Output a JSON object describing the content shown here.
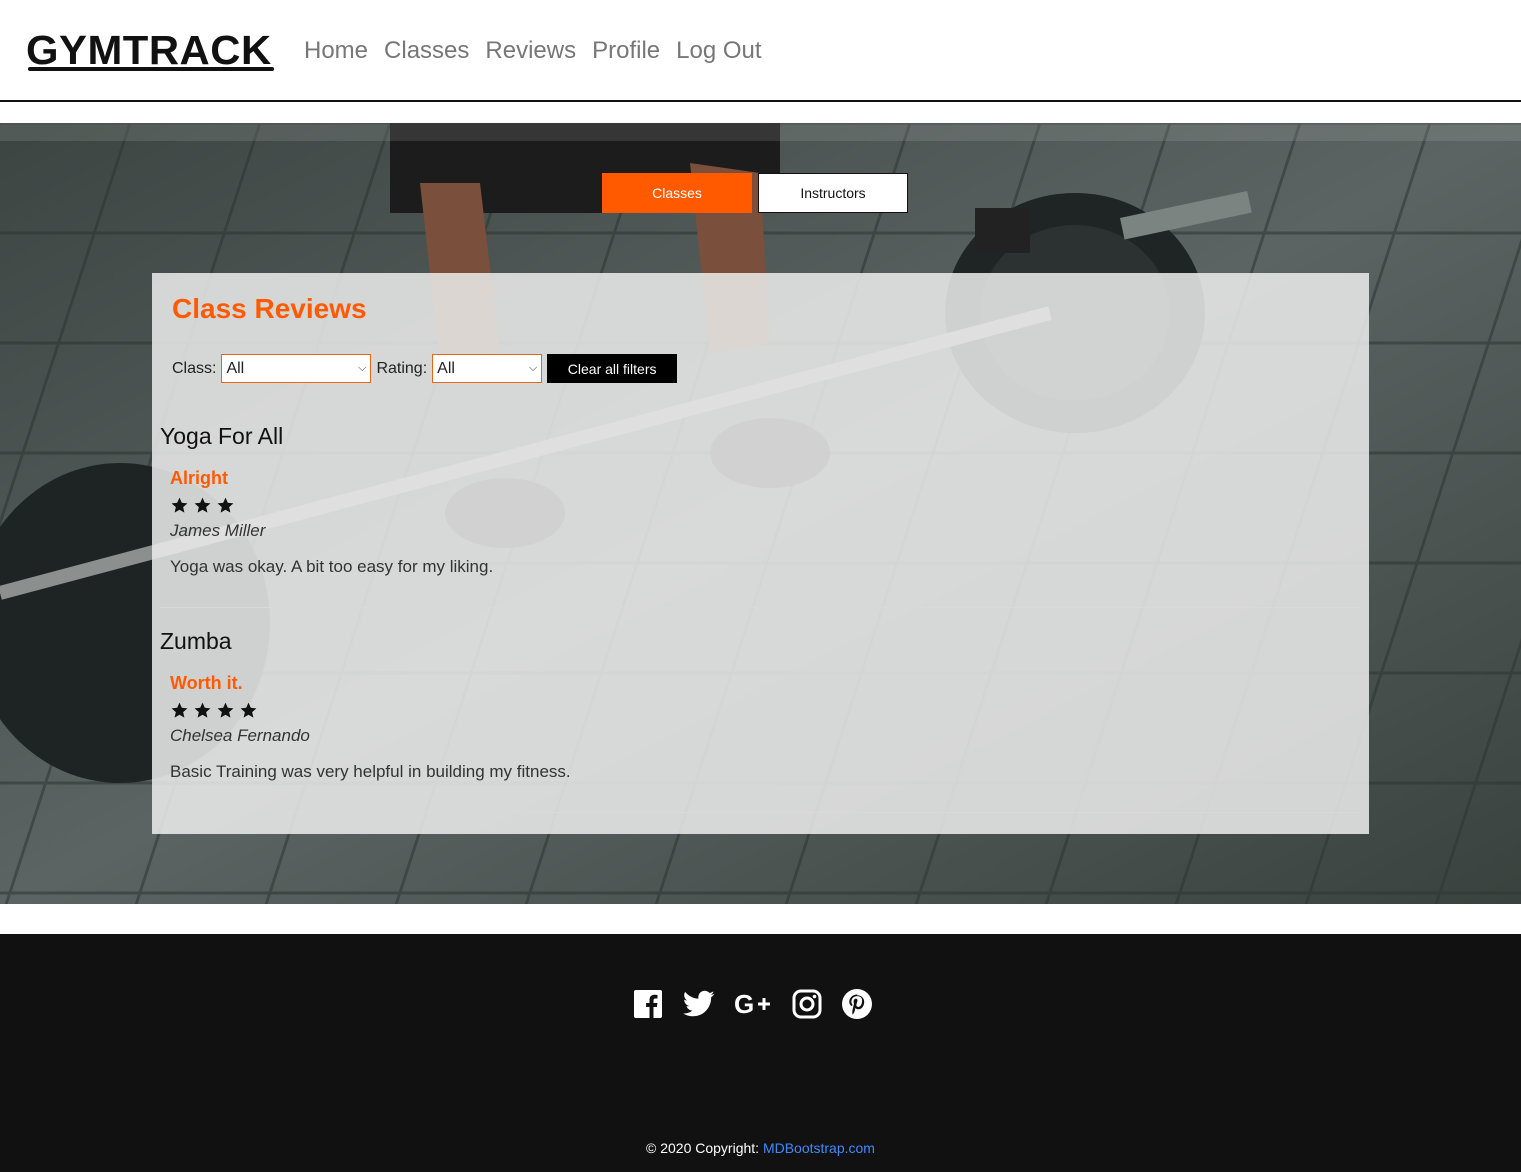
{
  "header": {
    "logo_text": "GYMTRACK",
    "nav": [
      "Home",
      "Classes",
      "Reviews",
      "Profile",
      "Log Out"
    ]
  },
  "toggle": {
    "classes_label": "Classes",
    "instructors_label": "Instructors",
    "active": "Classes"
  },
  "reviews_panel": {
    "title": "Class Reviews",
    "filters": {
      "class_label": "Class:",
      "class_value": "All",
      "rating_label": "Rating:",
      "rating_value": "All",
      "clear_label": "Clear all filters"
    },
    "groups": [
      {
        "class_name": "Yoga For All",
        "review": {
          "title": "Alright",
          "rating": 3,
          "reviewer": "James Miller",
          "text": "Yoga was okay. A bit too easy for my liking."
        }
      },
      {
        "class_name": "Zumba",
        "review": {
          "title": "Worth it.",
          "rating": 4,
          "reviewer": "Chelsea Fernando",
          "text": "Basic Training was very helpful in building my fitness."
        }
      }
    ]
  },
  "footer": {
    "social_icons": [
      "facebook-icon",
      "twitter-icon",
      "google-plus-icon",
      "instagram-icon",
      "pinterest-icon"
    ],
    "copyright_prefix": "© 2020 Copyright:",
    "copyright_link": "MDBootstrap.com"
  },
  "colors": {
    "accent": "#ff5a00",
    "footer_bg": "#111111",
    "link": "#3d8bfd"
  }
}
